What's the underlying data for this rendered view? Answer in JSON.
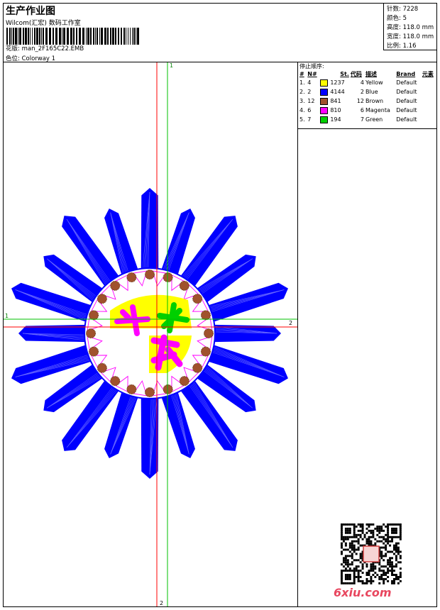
{
  "header": {
    "title": "生产作业图",
    "subtitle": "Wilcom(汇宏) 数码工作室",
    "design_label": "花版:",
    "design_value": "man_2F165C22.EMB",
    "colorway_label": "色位:",
    "colorway_value": "Colorway 1"
  },
  "stats": {
    "stitches_label": "针数:",
    "stitches_value": "7228",
    "colors_label": "颜色:",
    "colors_value": "5",
    "height_label": "高度:",
    "height_value": "118.0 mm",
    "width_label": "宽度:",
    "width_value": "118.0 mm",
    "scale_label": "比例:",
    "scale_value": "1.16"
  },
  "legend": {
    "title": "停止顺序:",
    "columns": [
      "#",
      "N#",
      "St.",
      "代码",
      "描述",
      "Brand",
      "元素"
    ],
    "rows": [
      {
        "idx": "1.",
        "n": "4",
        "st": "1237",
        "code": "4",
        "desc": "Yellow",
        "brand": "Default",
        "color": "#ffff00"
      },
      {
        "idx": "2.",
        "n": "2",
        "st": "4144",
        "code": "2",
        "desc": "Blue",
        "brand": "Default",
        "color": "#0000ff"
      },
      {
        "idx": "3.",
        "n": "12",
        "st": "841",
        "code": "12",
        "desc": "Brown",
        "brand": "Default",
        "color": "#a0522d"
      },
      {
        "idx": "4.",
        "n": "6",
        "st": "810",
        "code": "6",
        "desc": "Magenta",
        "brand": "Default",
        "color": "#ff00ff"
      },
      {
        "idx": "5.",
        "n": "7",
        "st": "194",
        "code": "7",
        "desc": "Green",
        "brand": "Default",
        "color": "#00d000"
      }
    ]
  },
  "axes": {
    "vert_top_label": "1",
    "vert_bottom_label": "2",
    "horiz_left_label": "1",
    "horiz_right_label": "2"
  },
  "watermark": {
    "site": "6xiu.com"
  }
}
